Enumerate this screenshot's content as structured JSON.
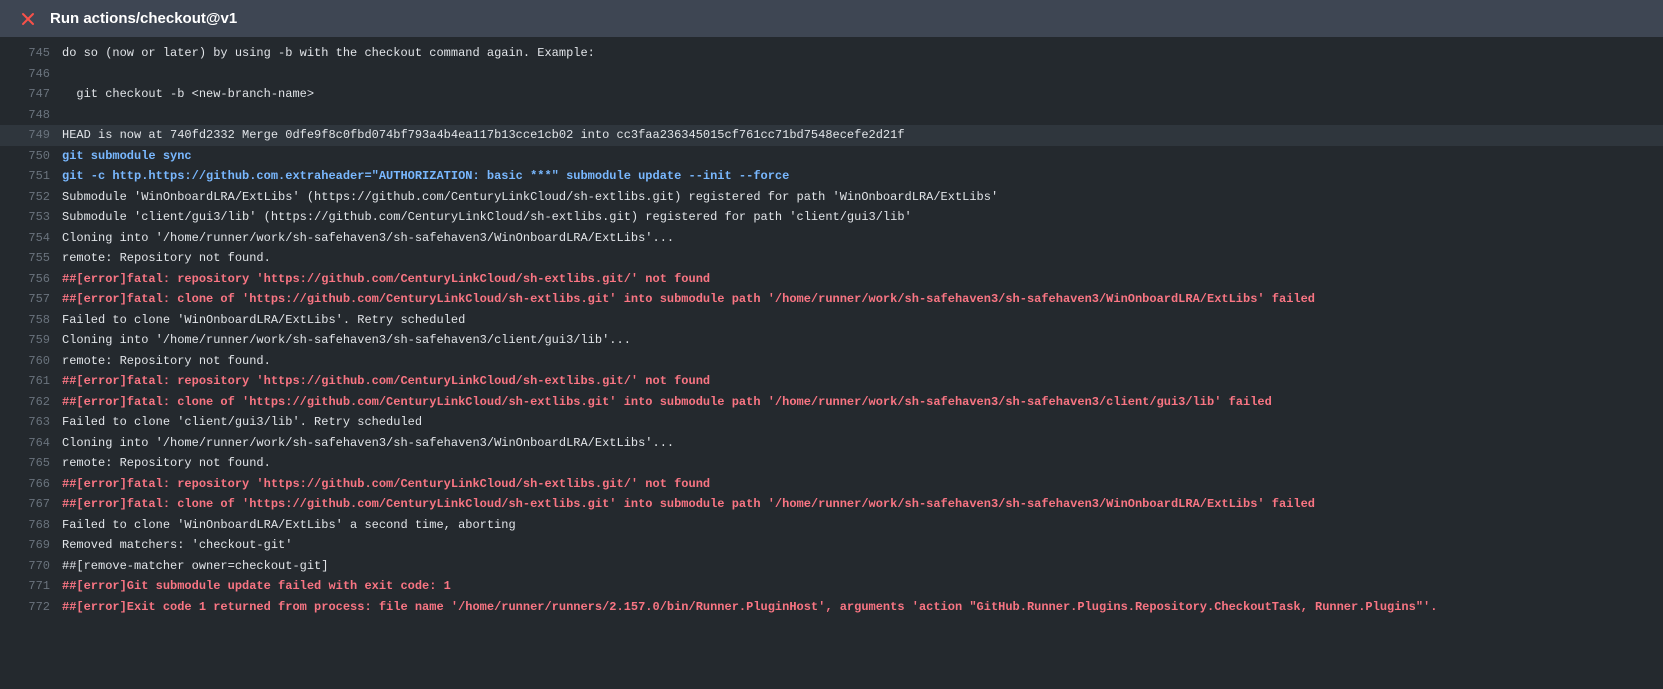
{
  "header": {
    "icon": "close-error-icon",
    "title": "Run actions/checkout@v1"
  },
  "log": [
    {
      "n": 745,
      "type": "plain",
      "hl": false,
      "text": "do so (now or later) by using -b with the checkout command again. Example:"
    },
    {
      "n": 746,
      "type": "plain",
      "hl": false,
      "text": ""
    },
    {
      "n": 747,
      "type": "plain",
      "hl": false,
      "text": "  git checkout -b <new-branch-name>"
    },
    {
      "n": 748,
      "type": "plain",
      "hl": false,
      "text": ""
    },
    {
      "n": 749,
      "type": "plain",
      "hl": true,
      "text": "HEAD is now at 740fd2332 Merge 0dfe9f8c0fbd074bf793a4b4ea117b13cce1cb02 into cc3faa236345015cf761cc71bd7548ecefe2d21f"
    },
    {
      "n": 750,
      "type": "cmd",
      "hl": false,
      "text": "git submodule sync"
    },
    {
      "n": 751,
      "type": "cmd",
      "hl": false,
      "text": "git -c http.https://github.com.extraheader=\"AUTHORIZATION: basic ***\" submodule update --init --force"
    },
    {
      "n": 752,
      "type": "plain",
      "hl": false,
      "text": "Submodule 'WinOnboardLRA/ExtLibs' (https://github.com/CenturyLinkCloud/sh-extlibs.git) registered for path 'WinOnboardLRA/ExtLibs'"
    },
    {
      "n": 753,
      "type": "plain",
      "hl": false,
      "text": "Submodule 'client/gui3/lib' (https://github.com/CenturyLinkCloud/sh-extlibs.git) registered for path 'client/gui3/lib'"
    },
    {
      "n": 754,
      "type": "plain",
      "hl": false,
      "text": "Cloning into '/home/runner/work/sh-safehaven3/sh-safehaven3/WinOnboardLRA/ExtLibs'..."
    },
    {
      "n": 755,
      "type": "plain",
      "hl": false,
      "text": "remote: Repository not found."
    },
    {
      "n": 756,
      "type": "err",
      "hl": false,
      "text": "##[error]fatal: repository 'https://github.com/CenturyLinkCloud/sh-extlibs.git/' not found"
    },
    {
      "n": 757,
      "type": "err",
      "hl": false,
      "text": "##[error]fatal: clone of 'https://github.com/CenturyLinkCloud/sh-extlibs.git' into submodule path '/home/runner/work/sh-safehaven3/sh-safehaven3/WinOnboardLRA/ExtLibs' failed"
    },
    {
      "n": 758,
      "type": "plain",
      "hl": false,
      "text": "Failed to clone 'WinOnboardLRA/ExtLibs'. Retry scheduled"
    },
    {
      "n": 759,
      "type": "plain",
      "hl": false,
      "text": "Cloning into '/home/runner/work/sh-safehaven3/sh-safehaven3/client/gui3/lib'..."
    },
    {
      "n": 760,
      "type": "plain",
      "hl": false,
      "text": "remote: Repository not found."
    },
    {
      "n": 761,
      "type": "err",
      "hl": false,
      "text": "##[error]fatal: repository 'https://github.com/CenturyLinkCloud/sh-extlibs.git/' not found"
    },
    {
      "n": 762,
      "type": "err",
      "hl": false,
      "text": "##[error]fatal: clone of 'https://github.com/CenturyLinkCloud/sh-extlibs.git' into submodule path '/home/runner/work/sh-safehaven3/sh-safehaven3/client/gui3/lib' failed"
    },
    {
      "n": 763,
      "type": "plain",
      "hl": false,
      "text": "Failed to clone 'client/gui3/lib'. Retry scheduled"
    },
    {
      "n": 764,
      "type": "plain",
      "hl": false,
      "text": "Cloning into '/home/runner/work/sh-safehaven3/sh-safehaven3/WinOnboardLRA/ExtLibs'..."
    },
    {
      "n": 765,
      "type": "plain",
      "hl": false,
      "text": "remote: Repository not found."
    },
    {
      "n": 766,
      "type": "err",
      "hl": false,
      "text": "##[error]fatal: repository 'https://github.com/CenturyLinkCloud/sh-extlibs.git/' not found"
    },
    {
      "n": 767,
      "type": "err",
      "hl": false,
      "text": "##[error]fatal: clone of 'https://github.com/CenturyLinkCloud/sh-extlibs.git' into submodule path '/home/runner/work/sh-safehaven3/sh-safehaven3/WinOnboardLRA/ExtLibs' failed"
    },
    {
      "n": 768,
      "type": "plain",
      "hl": false,
      "text": "Failed to clone 'WinOnboardLRA/ExtLibs' a second time, aborting"
    },
    {
      "n": 769,
      "type": "plain",
      "hl": false,
      "text": "Removed matchers: 'checkout-git'"
    },
    {
      "n": 770,
      "type": "plain",
      "hl": false,
      "text": "##[remove-matcher owner=checkout-git]"
    },
    {
      "n": 771,
      "type": "err",
      "hl": false,
      "text": "##[error]Git submodule update failed with exit code: 1"
    },
    {
      "n": 772,
      "type": "err",
      "hl": false,
      "text": "##[error]Exit code 1 returned from process: file name '/home/runner/runners/2.157.0/bin/Runner.PluginHost', arguments 'action \"GitHub.Runner.Plugins.Repository.CheckoutTask, Runner.Plugins\"'."
    }
  ]
}
